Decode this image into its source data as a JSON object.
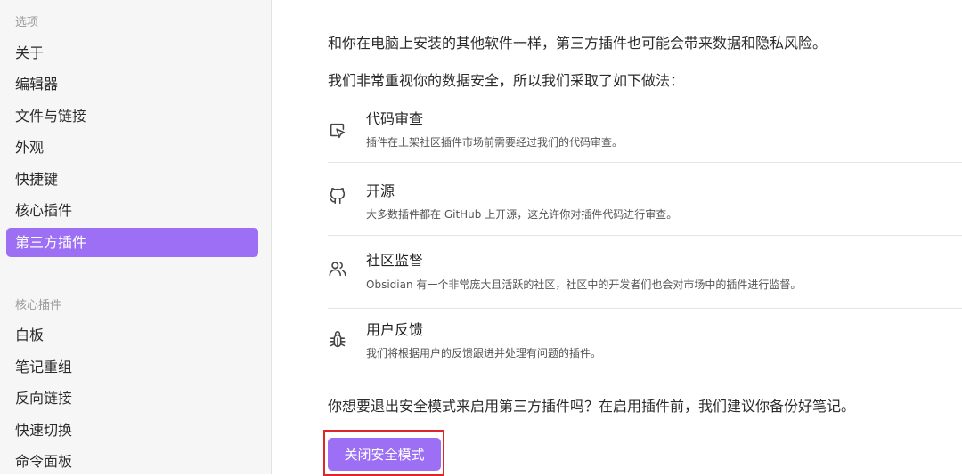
{
  "sidebar": {
    "options_header": "选项",
    "options_items": [
      {
        "label": "关于",
        "active": false
      },
      {
        "label": "编辑器",
        "active": false
      },
      {
        "label": "文件与链接",
        "active": false
      },
      {
        "label": "外观",
        "active": false
      },
      {
        "label": "快捷键",
        "active": false
      },
      {
        "label": "核心插件",
        "active": false
      },
      {
        "label": "第三方插件",
        "active": true
      }
    ],
    "core_plugins_header": "核心插件",
    "core_plugin_items": [
      {
        "label": "白板"
      },
      {
        "label": "笔记重组"
      },
      {
        "label": "反向链接"
      },
      {
        "label": "快速切换"
      },
      {
        "label": "命令面板"
      }
    ]
  },
  "main": {
    "intro": "和你在电脑上安装的其他软件一样，第三方插件也可能会带来数据和隐私风险。",
    "measures_intro": "我们非常重视你的数据安全，所以我们采取了如下做法：",
    "features": [
      {
        "icon": "code-review-icon",
        "title": "代码审查",
        "description": "插件在上架社区插件市场前需要经过我们的代码审查。"
      },
      {
        "icon": "github-icon",
        "title": "开源",
        "description": "大多数插件都在 GitHub 上开源，这允许你对插件代码进行审查。"
      },
      {
        "icon": "users-icon",
        "title": "社区监督",
        "description": "Obsidian 有一个非常庞大且活跃的社区，社区中的开发者们也会对市场中的插件进行监督。"
      },
      {
        "icon": "bug-icon",
        "title": "用户反馈",
        "description": "我们将根据用户的反馈跟进并处理有问题的插件。"
      }
    ],
    "question": "你想要退出安全模式来启用第三方插件吗？在启用插件前，我们建议你备份好笔记。",
    "turn_off_button": "关闭安全模式"
  },
  "colors": {
    "accent": "#9c6ff4",
    "highlight_frame": "#e0252b"
  }
}
